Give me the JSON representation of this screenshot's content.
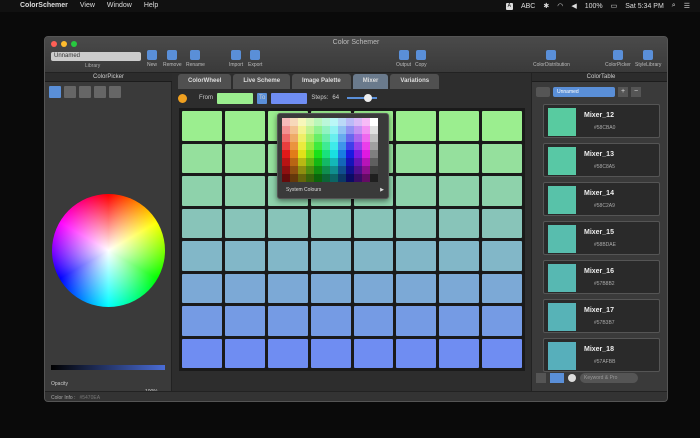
{
  "menubar": {
    "app_name": "ColorSchemer",
    "items": [
      "View",
      "Window",
      "Help"
    ],
    "status": {
      "keyboard": "ABC",
      "battery": "100%",
      "clock": "Sat 5:34 PM",
      "flag": "A"
    }
  },
  "window": {
    "title": "Color Schemer",
    "library_value": "Unnamed",
    "library_label": "Library",
    "toolbar_left": [
      {
        "label": "New"
      },
      {
        "label": "Remove"
      },
      {
        "label": "Rename"
      },
      {
        "label": "Import"
      },
      {
        "label": "Export"
      },
      {
        "label": "Output"
      },
      {
        "label": "Copy"
      }
    ],
    "toolbar_right": [
      {
        "label": "ColorDistribution"
      },
      {
        "label": "ColorPicker"
      },
      {
        "label": "StyleLibrary"
      }
    ]
  },
  "picker": {
    "title": "ColorPicker",
    "opacity_label": "Opacity",
    "opacity_value": "100%",
    "opacity_fraction": 1.0,
    "current_color": "#5B78E3",
    "swatches": [
      "#000000",
      "#3a3a3a",
      "#777777",
      "#bbbbbb",
      "#ffffff",
      "#ff0000",
      "#ff8800",
      "#ffff00",
      "#00cc00",
      "#00cccc",
      "#0000ff",
      "#880088",
      "#ff00ff",
      "#aa5500",
      "#ff9999",
      "#ffcc88",
      "#ffff99",
      "#99ff99",
      "#99ffff",
      "#9999ff",
      "#cc99ff",
      "#ff99ff"
    ]
  },
  "main": {
    "tabs": [
      {
        "label": "ColorWheel"
      },
      {
        "label": "Live Scheme"
      },
      {
        "label": "Image Palette"
      },
      {
        "label": "Mixer"
      },
      {
        "label": "Variations"
      }
    ],
    "active_tab": "Mixer",
    "from_label": "From",
    "to_label": "To",
    "from_color": "#9BEE8F",
    "to_color": "#6F8DF2",
    "steps_label": "Steps:",
    "steps_value": "64",
    "steps_fraction": 0.8
  },
  "dropdown": {
    "label": "System Colours",
    "arrow": "▶"
  },
  "table": {
    "title": "ColorTable",
    "select_value": "Unnamed",
    "search_placeholder": "Keyword & Pro",
    "entries": [
      {
        "name": "Mixer_12",
        "hex": "#58CBA0",
        "color": "#58CBA0"
      },
      {
        "name": "Mixer_13",
        "hex": "#58C8A5",
        "color": "#58C8A5"
      },
      {
        "name": "Mixer_14",
        "hex": "#58C2A9",
        "color": "#58C2A9"
      },
      {
        "name": "Mixer_15",
        "hex": "#58BDAE",
        "color": "#58BDAE"
      },
      {
        "name": "Mixer_16",
        "hex": "#57B8B2",
        "color": "#57B8B2"
      },
      {
        "name": "Mixer_17",
        "hex": "#57B3B7",
        "color": "#57B3B7"
      },
      {
        "name": "Mixer_18",
        "hex": "#57AFBB",
        "color": "#57AFBB"
      }
    ]
  },
  "status": {
    "label": "Color Info :",
    "value": "#5470EA"
  }
}
